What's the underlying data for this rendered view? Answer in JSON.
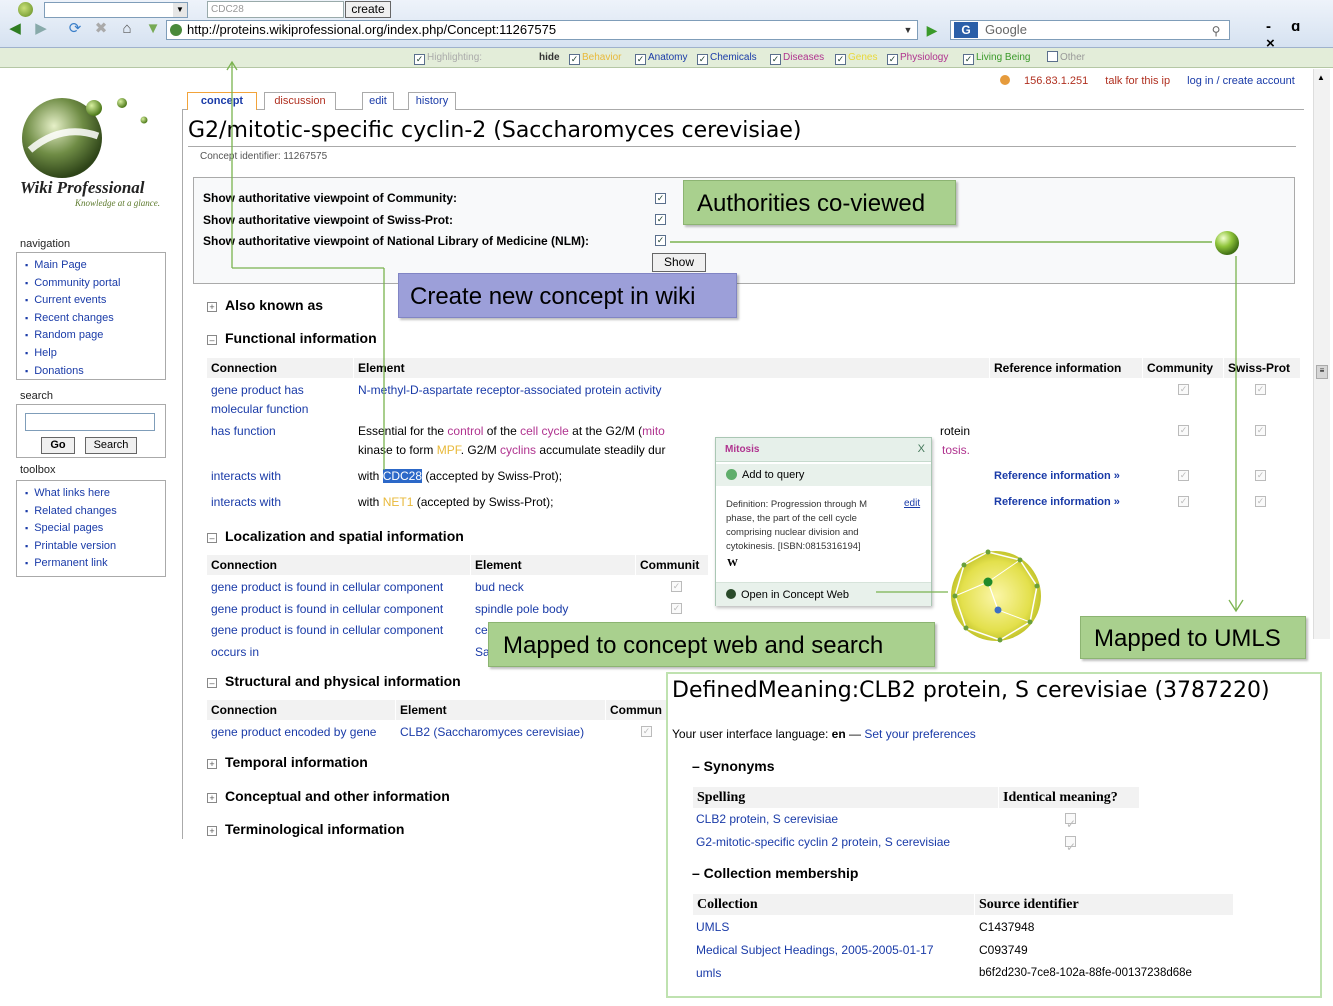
{
  "browser": {
    "url": "http://proteins.wikiprofessional.org/index.php/Concept:11267575",
    "search_placeholder": "Google",
    "search_engine_icon": "G",
    "window_controls": "- ɑ ×"
  },
  "toolbar": {
    "search_value": "CDC28",
    "create_label": "create",
    "highlighting_label": "Highlighting:",
    "hide_label": "hide",
    "categories": [
      {
        "label": "Behavior",
        "color": "#e8b93a"
      },
      {
        "label": "Anatomy",
        "color": "#1a3ba8"
      },
      {
        "label": "Chemicals",
        "color": "#1a3ba8"
      },
      {
        "label": "Diseases",
        "color": "#b0338f"
      },
      {
        "label": "Genes",
        "color": "#e8d83a"
      },
      {
        "label": "Physiology",
        "color": "#b0338f"
      },
      {
        "label": "Living Being",
        "color": "#3a9a2a"
      },
      {
        "label": "Other",
        "color": "#999999"
      }
    ]
  },
  "personal": {
    "ip": "156.83.1.251",
    "talk": "talk for this ip",
    "login": "log in / create account"
  },
  "logo": {
    "title": "Wiki Professional",
    "tagline": "Knowledge at a glance."
  },
  "sidebar": {
    "navigation_title": "navigation",
    "navigation": [
      "Main Page",
      "Community portal",
      "Current events",
      "Recent changes",
      "Random page",
      "Help",
      "Donations"
    ],
    "search_title": "search",
    "go_label": "Go",
    "search_label": "Search",
    "toolbox_title": "toolbox",
    "toolbox": [
      "What links here",
      "Related changes",
      "Special pages",
      "Printable version",
      "Permanent link"
    ]
  },
  "tabs": [
    "concept",
    "discussion",
    "edit",
    "history"
  ],
  "page": {
    "title": "G2/mitotic-specific cyclin-2 (Saccharomyces cerevisiae)",
    "concept_id": "Concept identifier: 11267575"
  },
  "authority": {
    "rows": [
      "Show authoritative viewpoint of Community:",
      "Show authoritative viewpoint of Swiss-Prot:",
      "Show authoritative viewpoint of National Library of Medicine (NLM):"
    ],
    "show_label": "Show"
  },
  "sections": {
    "also_known": "Also known as",
    "functional": "Functional information",
    "localization": "Localization and spatial information",
    "structural": "Structural and physical information",
    "temporal": "Temporal information",
    "conceptual": "Conceptual and other information",
    "terminological": "Terminological information"
  },
  "functional_table": {
    "headers": [
      "Connection",
      "Element",
      "Reference information",
      "Community",
      "Swiss-Prot"
    ],
    "rows": [
      {
        "connection_1": "gene product has",
        "connection_2": "molecular function",
        "element": "N-methyl-D-aspartate receptor-associated protein activity"
      },
      {
        "connection": "has function",
        "line1_a": "Essential for the ",
        "line1_b": "control",
        "line1_c": " of the ",
        "line1_d": "cell cycle",
        "line1_e": " at the G2/M (",
        "line1_f": "mito",
        "line1_g": "rotein",
        "line2_a": "kinase to form ",
        "line2_b": "MPF",
        "line2_c": ". G2/M ",
        "line2_d": "cyclins",
        "line2_e": " accumulate steadily dur",
        "line2_f": "tosis."
      },
      {
        "connection": "interacts with",
        "el_a": "with ",
        "el_b": "CDC28",
        "el_c": " (accepted by Swiss-Prot);",
        "reference": "Reference information »"
      },
      {
        "connection": "interacts with",
        "el_a": "with ",
        "el_b": "NET1",
        "el_c": " (accepted by Swiss-Prot);",
        "reference": "Reference information »"
      }
    ]
  },
  "localization_table": {
    "headers": [
      "Connection",
      "Element",
      "Communit"
    ],
    "rows": [
      {
        "connection": "gene product is found in cellular component",
        "element": "bud neck"
      },
      {
        "connection": "gene product is found in cellular component",
        "element": "spindle pole body"
      },
      {
        "connection": "gene product is found in cellular component",
        "element": "ce"
      },
      {
        "connection": "occurs in",
        "element": "Sa"
      }
    ]
  },
  "structural_table": {
    "headers": [
      "Connection",
      "Element",
      "Commun"
    ],
    "rows": [
      {
        "connection": "gene product encoded by gene",
        "element": "CLB2 (Saccharomyces cerevisiae)"
      }
    ]
  },
  "popup": {
    "title": "Mitosis",
    "close": "X",
    "add_to_query": "Add to query",
    "definition": "Definition: Progression through M phase, the part of the cell cycle comprising nuclear division and cytokinesis. [ISBN:0815316194]",
    "edit": "edit",
    "w": "W",
    "open_concept_web": "Open in Concept Web"
  },
  "callouts": {
    "authorities": "Authorities co-viewed",
    "create": "Create new concept in wiki",
    "mapped_web": "Mapped to concept web and search",
    "mapped_umls": "Mapped to UMLS"
  },
  "defined_meaning": {
    "title": "DefinedMeaning:CLB2 protein, S cerevisiae (3787220)",
    "lang_prefix": "Your user interface language: ",
    "lang": "en",
    "lang_sep": " — ",
    "set_prefs": "Set your preferences",
    "synonyms_title": "–  Synonyms",
    "synonyms_headers": [
      "Spelling",
      "Identical meaning?"
    ],
    "synonyms": [
      "CLB2 protein, S cerevisiae",
      "G2-mitotic-specific cyclin 2 protein, S cerevisiae"
    ],
    "collection_title": "–  Collection membership",
    "collection_headers": [
      "Collection",
      "Source identifier"
    ],
    "collections": [
      {
        "collection": "UMLS",
        "id": "C1437948"
      },
      {
        "collection": "Medical Subject Headings, 2005-2005-01-17",
        "id": "C093749"
      },
      {
        "collection": "umls",
        "id": "b6f2d230-7ce8-102a-88fe-00137238d68e"
      }
    ]
  }
}
